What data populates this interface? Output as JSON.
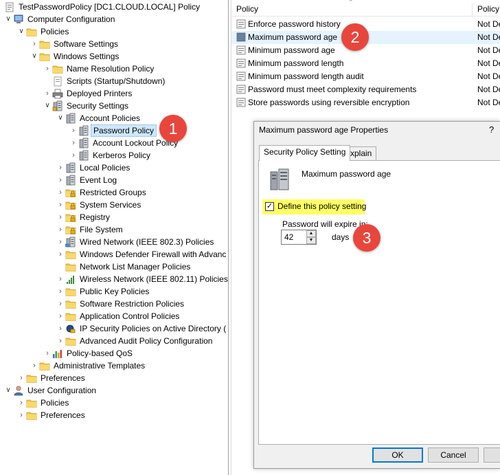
{
  "tree": {
    "rows": [
      {
        "label": "TestPasswordPolicy [DC1.CLOUD.LOCAL] Policy",
        "icon": "gpo-scroll-icon",
        "arrow": ""
      },
      {
        "label": "Computer Configuration",
        "icon": "computer-icon",
        "arrow": "expanded"
      },
      {
        "label": "Policies",
        "icon": "folder-icon",
        "arrow": "expanded"
      },
      {
        "label": "Software Settings",
        "icon": "folder-icon",
        "arrow": "collapsed"
      },
      {
        "label": "Windows Settings",
        "icon": "folder-icon",
        "arrow": "expanded"
      },
      {
        "label": "Name Resolution Policy",
        "icon": "folder-icon",
        "arrow": "collapsed"
      },
      {
        "label": "Scripts (Startup/Shutdown)",
        "icon": "script-icon",
        "arrow": ""
      },
      {
        "label": "Deployed Printers",
        "icon": "printer-icon",
        "arrow": "collapsed"
      },
      {
        "label": "Security Settings",
        "icon": "security-icon",
        "arrow": "expanded"
      },
      {
        "label": "Account Policies",
        "icon": "policy-icon",
        "arrow": "expanded"
      },
      {
        "label": "Password Policy",
        "icon": "policy-icon",
        "arrow": "collapsed"
      },
      {
        "label": "Account Lockout Policy",
        "icon": "policy-icon",
        "arrow": "collapsed"
      },
      {
        "label": "Kerberos Policy",
        "icon": "policy-icon",
        "arrow": "collapsed"
      },
      {
        "label": "Local Policies",
        "icon": "policy-icon",
        "arrow": "collapsed"
      },
      {
        "label": "Event Log",
        "icon": "policy-icon",
        "arrow": "collapsed"
      },
      {
        "label": "Restricted Groups",
        "icon": "lock-folder-icon",
        "arrow": "collapsed"
      },
      {
        "label": "System Services",
        "icon": "lock-folder-icon",
        "arrow": "collapsed"
      },
      {
        "label": "Registry",
        "icon": "lock-folder-icon",
        "arrow": "collapsed"
      },
      {
        "label": "File System",
        "icon": "lock-folder-icon",
        "arrow": "collapsed"
      },
      {
        "label": "Wired Network (IEEE 802.3) Policies",
        "icon": "network-icon",
        "arrow": "collapsed"
      },
      {
        "label": "Windows Defender Firewall with Advanc",
        "icon": "folder-icon",
        "arrow": "collapsed"
      },
      {
        "label": "Network List Manager Policies",
        "icon": "folder-icon",
        "arrow": ""
      },
      {
        "label": "Wireless Network (IEEE 802.11) Policies",
        "icon": "wireless-icon",
        "arrow": "collapsed"
      },
      {
        "label": "Public Key Policies",
        "icon": "folder-icon",
        "arrow": "collapsed"
      },
      {
        "label": "Software Restriction Policies",
        "icon": "folder-icon",
        "arrow": "collapsed"
      },
      {
        "label": "Application Control Policies",
        "icon": "folder-icon",
        "arrow": "collapsed"
      },
      {
        "label": "IP Security Policies on Active Directory (",
        "icon": "ipsec-icon",
        "arrow": "collapsed"
      },
      {
        "label": "Advanced Audit Policy Configuration",
        "icon": "folder-icon",
        "arrow": "collapsed"
      },
      {
        "label": "Policy-based QoS",
        "icon": "qos-chart-icon",
        "arrow": "collapsed"
      },
      {
        "label": "Administrative Templates",
        "icon": "folder-icon",
        "arrow": "collapsed"
      },
      {
        "label": "Preferences",
        "icon": "folder-icon",
        "arrow": "collapsed"
      },
      {
        "label": "User Configuration",
        "icon": "user-icon",
        "arrow": "expanded"
      },
      {
        "label": "Policies",
        "icon": "folder-icon",
        "arrow": "collapsed"
      },
      {
        "label": "Preferences",
        "icon": "folder-icon",
        "arrow": "collapsed"
      }
    ],
    "selected_label": "Password Policy"
  },
  "list": {
    "columns": [
      "Policy",
      "Policy"
    ],
    "rows": [
      {
        "name": "Enforce password history",
        "value": "Not De"
      },
      {
        "name": "Maximum password age",
        "value": "Not De"
      },
      {
        "name": "Minimum password age",
        "value": "Not De"
      },
      {
        "name": "Minimum password length",
        "value": "Not De"
      },
      {
        "name": "Minimum password length audit",
        "value": "Not De"
      },
      {
        "name": "Password must meet complexity requirements",
        "value": "Not De"
      },
      {
        "name": "Store passwords using reversible encryption",
        "value": "Not De"
      }
    ],
    "highlighted_row": "Maximum password age"
  },
  "dialog": {
    "title": "Maximum password age Properties",
    "help": "?",
    "tabs": [
      "Security Policy Setting",
      "Explain"
    ],
    "policy_name": "Maximum password age",
    "define_checkbox_label": "Define this policy setting",
    "define_checked": true,
    "expire_label": "Password will expire in:",
    "expire_value": "42",
    "expire_unit": "days",
    "ok_label": "OK",
    "cancel_label": "Cancel"
  },
  "callouts": [
    "1",
    "2",
    "3"
  ],
  "colors": {
    "callout": "#e8463c",
    "highlight": "#ffff66",
    "selection": "#cde8ff",
    "row_hover": "#e5f3ff",
    "accent": "#0078d7"
  }
}
